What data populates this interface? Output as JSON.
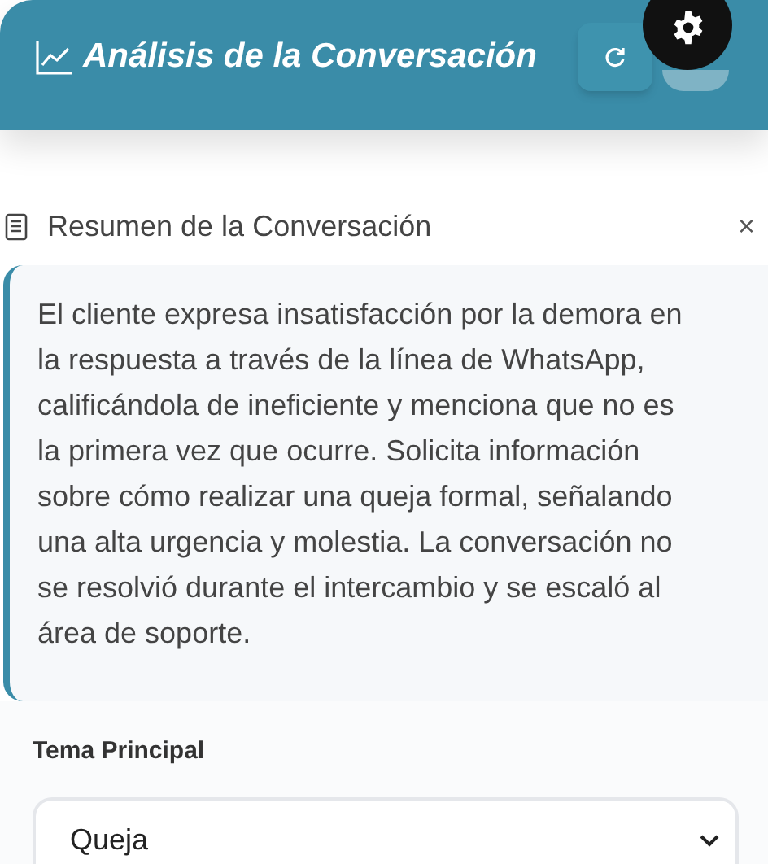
{
  "header": {
    "title": "Análisis de la Conversación"
  },
  "summary": {
    "title": "Resumen de la Conversación",
    "close": "×",
    "text": "El cliente expresa insatisfacción por la demora en la respuesta a través de la línea de WhatsApp, calificándola de ineficiente y menciona que no es la primera vez que ocurre. Solicita información sobre cómo realizar una queja formal, señalando una alta urgencia y molestia. La conversación no se resolvió durante el intercambio y se escaló al área de soporte."
  },
  "main_topic": {
    "label": "Tema Principal",
    "value": "Queja"
  }
}
